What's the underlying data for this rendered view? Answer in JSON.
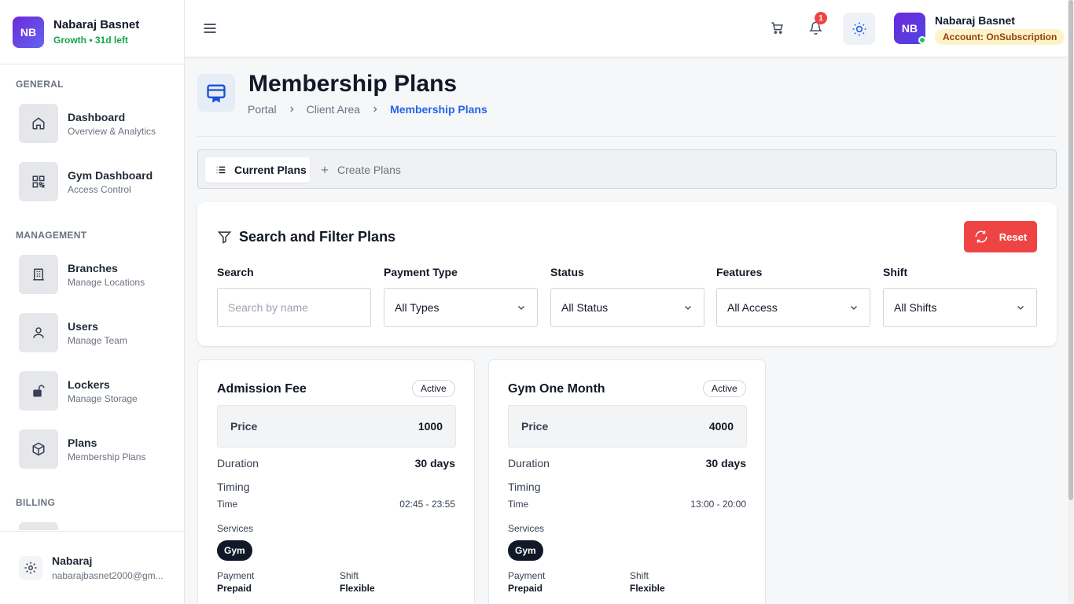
{
  "org": {
    "initials": "NB",
    "name": "Nabaraj Basnet",
    "subtitle": "Growth • 31d left"
  },
  "sidebar": {
    "sections": {
      "general": "GENERAL",
      "management": "MANAGEMENT",
      "billing": "BILLING"
    },
    "items": [
      {
        "title": "Dashboard",
        "desc": "Overview & Analytics",
        "icon": "home-icon"
      },
      {
        "title": "Gym Dashboard",
        "desc": "Access Control",
        "icon": "qr-code-icon"
      },
      {
        "title": "Branches",
        "desc": "Manage Locations",
        "icon": "building-icon"
      },
      {
        "title": "Users",
        "desc": "Manage Team",
        "icon": "user-icon"
      },
      {
        "title": "Lockers",
        "desc": "Manage Storage",
        "icon": "lock-open-icon"
      },
      {
        "title": "Plans",
        "desc": "Membership Plans",
        "icon": "package-icon"
      }
    ],
    "footer": {
      "name": "Nabaraj",
      "email": "nabarajbasnet2000@gm..."
    }
  },
  "header": {
    "notification_count": "1",
    "user_initials": "NB",
    "user_name": "Nabaraj Basnet",
    "account_badge": "Account: OnSubscription"
  },
  "page": {
    "title": "Membership Plans",
    "breadcrumb": [
      "Portal",
      "Client Area",
      "Membership Plans"
    ]
  },
  "tabs": {
    "current": "Current Plans",
    "create": "Create Plans"
  },
  "filters": {
    "title": "Search and Filter Plans",
    "reset_label": "Reset",
    "search_label": "Search",
    "search_placeholder": "Search by name",
    "payment_label": "Payment Type",
    "payment_value": "All Types",
    "status_label": "Status",
    "status_value": "All Status",
    "features_label": "Features",
    "features_value": "All Access",
    "shift_label": "Shift",
    "shift_value": "All Shifts"
  },
  "plans": [
    {
      "name": "Admission Fee",
      "status": "Active",
      "price_label": "Price",
      "price": "1000",
      "duration_label": "Duration",
      "duration": "30 days",
      "timing_label": "Timing",
      "time_label": "Time",
      "time": "02:45 - 23:55",
      "services_label": "Services",
      "service": "Gym",
      "payment_label": "Payment",
      "payment": "Prepaid",
      "shift_label": "Shift",
      "shift": "Flexible"
    },
    {
      "name": "Gym One Month",
      "status": "Active",
      "price_label": "Price",
      "price": "4000",
      "duration_label": "Duration",
      "duration": "30 days",
      "timing_label": "Timing",
      "time_label": "Time",
      "time": "13:00 - 20:00",
      "services_label": "Services",
      "service": "Gym",
      "payment_label": "Payment",
      "payment": "Prepaid",
      "shift_label": "Shift",
      "shift": "Flexible"
    }
  ],
  "colors": {
    "accent": "#2563eb",
    "danger": "#ef4444",
    "success": "#16a34a",
    "badge_bg": "#fef3c7"
  }
}
